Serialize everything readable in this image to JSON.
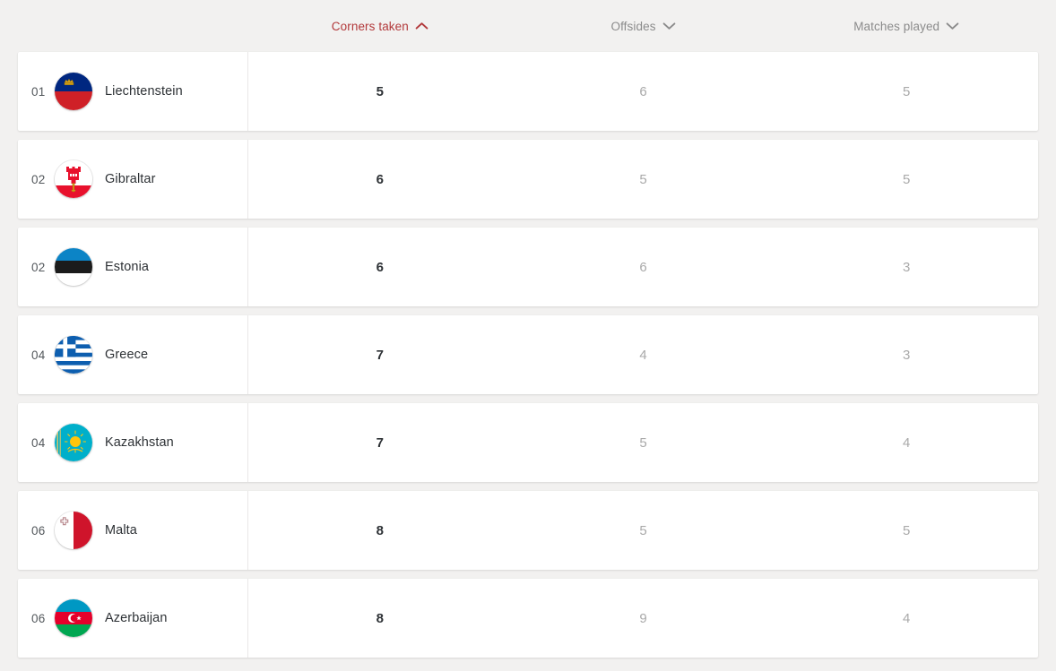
{
  "table": {
    "columns": [
      {
        "id": "name",
        "label": "",
        "sortable": false,
        "sort": "none",
        "active": false
      },
      {
        "id": "corners_taken",
        "label": "Corners taken",
        "sortable": true,
        "sort": "asc",
        "active": true
      },
      {
        "id": "offsides",
        "label": "Offsides",
        "sortable": true,
        "sort": "desc",
        "active": false
      },
      {
        "id": "matches_played",
        "label": "Matches played",
        "sortable": true,
        "sort": "desc",
        "active": false
      }
    ],
    "sorted_by": "Corners taken",
    "sort_direction": "ascending",
    "rows": [
      {
        "rank": "01",
        "country": "Liechtenstein",
        "flag": "liechtenstein",
        "corners_taken": "5",
        "offsides": "6",
        "matches_played": "5"
      },
      {
        "rank": "02",
        "country": "Gibraltar",
        "flag": "gibraltar",
        "corners_taken": "6",
        "offsides": "5",
        "matches_played": "5"
      },
      {
        "rank": "02",
        "country": "Estonia",
        "flag": "estonia",
        "corners_taken": "6",
        "offsides": "6",
        "matches_played": "3"
      },
      {
        "rank": "04",
        "country": "Greece",
        "flag": "greece",
        "corners_taken": "7",
        "offsides": "4",
        "matches_played": "3"
      },
      {
        "rank": "04",
        "country": "Kazakhstan",
        "flag": "kazakhstan",
        "corners_taken": "7",
        "offsides": "5",
        "matches_played": "4"
      },
      {
        "rank": "06",
        "country": "Malta",
        "flag": "malta",
        "corners_taken": "8",
        "offsides": "5",
        "matches_played": "5"
      },
      {
        "rank": "06",
        "country": "Azerbaijan",
        "flag": "azerbaijan",
        "corners_taken": "8",
        "offsides": "9",
        "matches_played": "4"
      }
    ]
  },
  "icons": {
    "sort_asc": "chevron-up-icon",
    "sort_desc": "chevron-down-icon"
  },
  "colors": {
    "active_header": "#b2383a",
    "inactive_header": "#8b8b8b",
    "primary_value": "#2d3135",
    "secondary_value": "#a9a9a9",
    "page_background": "#f2f1f0",
    "row_background": "#ffffff"
  }
}
